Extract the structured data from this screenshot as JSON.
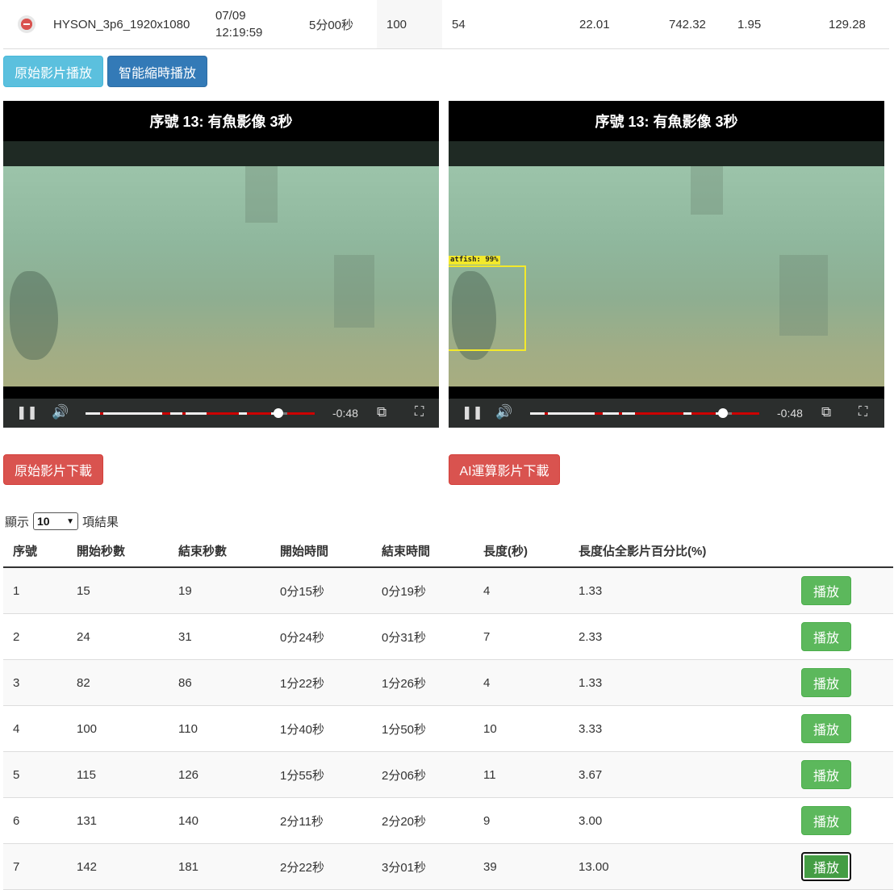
{
  "summary_row": {
    "name": "HYSON_3p6_1920x1080",
    "date": "07/09",
    "time": "12:19:59",
    "duration": "5分00秒",
    "col_a": "100",
    "col_b": "54",
    "col_c": "22.01",
    "col_d": "742.32",
    "col_e": "1.95",
    "col_f": "129.28"
  },
  "mode_buttons": {
    "original": "原始影片播放",
    "smart": "智能縮時播放"
  },
  "players": {
    "left": {
      "title": "序號 13: 有魚影像 3秒",
      "time_remaining": "-0:48",
      "progress": 0.84
    },
    "right": {
      "title": "序號 13: 有魚影像 3秒",
      "time_remaining": "-0:48",
      "progress": 0.84,
      "detection_label": "atfish: 99%"
    }
  },
  "download_buttons": {
    "original": "原始影片下載",
    "ai": "AI運算影片下載"
  },
  "entries": {
    "prefix": "顯示",
    "value": "10",
    "suffix": "項結果"
  },
  "table": {
    "headers": [
      "序號",
      "開始秒數",
      "結束秒數",
      "開始時間",
      "結束時間",
      "長度(秒)",
      "長度佔全影片百分比(%)"
    ],
    "play_label": "播放",
    "rows": [
      [
        "1",
        "15",
        "19",
        "0分15秒",
        "0分19秒",
        "4",
        "1.33"
      ],
      [
        "2",
        "24",
        "31",
        "0分24秒",
        "0分31秒",
        "7",
        "2.33"
      ],
      [
        "3",
        "82",
        "86",
        "1分22秒",
        "1分26秒",
        "4",
        "1.33"
      ],
      [
        "4",
        "100",
        "110",
        "1分40秒",
        "1分50秒",
        "10",
        "3.33"
      ],
      [
        "5",
        "115",
        "126",
        "1分55秒",
        "2分06秒",
        "11",
        "3.67"
      ],
      [
        "6",
        "131",
        "140",
        "2分11秒",
        "2分20秒",
        "9",
        "3.00"
      ],
      [
        "7",
        "142",
        "181",
        "2分22秒",
        "3分01秒",
        "39",
        "13.00"
      ]
    ],
    "active_row": 6
  },
  "colors": {
    "info": "#5bc0de",
    "primary": "#337ab7",
    "danger": "#d9534f",
    "success": "#5cb85c",
    "detection_box": "#f3e92b"
  }
}
